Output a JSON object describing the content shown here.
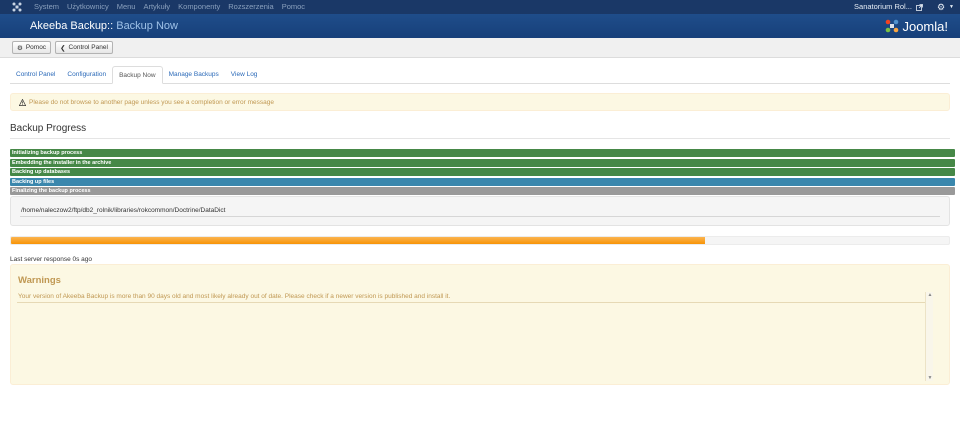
{
  "navbar": {
    "menu": [
      "System",
      "Użytkownicy",
      "Menu",
      "Artykuły",
      "Komponenty",
      "Rozszerzenia",
      "Pomoc"
    ],
    "site_name": "Sanatorium Rol..."
  },
  "header": {
    "title_main": "Akeeba Backup::",
    "title_sub": " Backup Now",
    "brand": "Joomla!"
  },
  "toolbar": {
    "help_label": "Pomoc",
    "control_panel_label": "Control Panel"
  },
  "tabs": [
    "Control Panel",
    "Configuration",
    "Backup Now",
    "Manage Backups",
    "View Log"
  ],
  "alert": {
    "text": "Please do not browse to another page unless you see a completion or error message"
  },
  "progress_section": {
    "title": "Backup Progress",
    "steps": [
      {
        "label": "Initializing backup process",
        "status": "done"
      },
      {
        "label": "Embedding the installer in the archive",
        "status": "done"
      },
      {
        "label": "Backing up databases",
        "status": "done"
      },
      {
        "label": "Backing up files",
        "status": "active"
      },
      {
        "label": "Finalizing the backup process",
        "status": "pending"
      }
    ],
    "current_path": "/home/naleczow2/ftp/db2_rolnik/libraries/rokcommon/Doctrine/DataDict",
    "percent": 74,
    "last_response": "Last server response 0s ago"
  },
  "warnings": {
    "title": "Warnings",
    "text": "Your version of Akeeba Backup is more than 90 days old and most likely already out of date. Please check if a newer version is published and install it."
  },
  "colors": {
    "navbar": "#1a3867",
    "header": "#1f4d8a",
    "step_done": "#468847",
    "step_active": "#3a87ad",
    "step_pending": "#999999",
    "progress": "#f89406",
    "warning_text": "#c09853"
  }
}
